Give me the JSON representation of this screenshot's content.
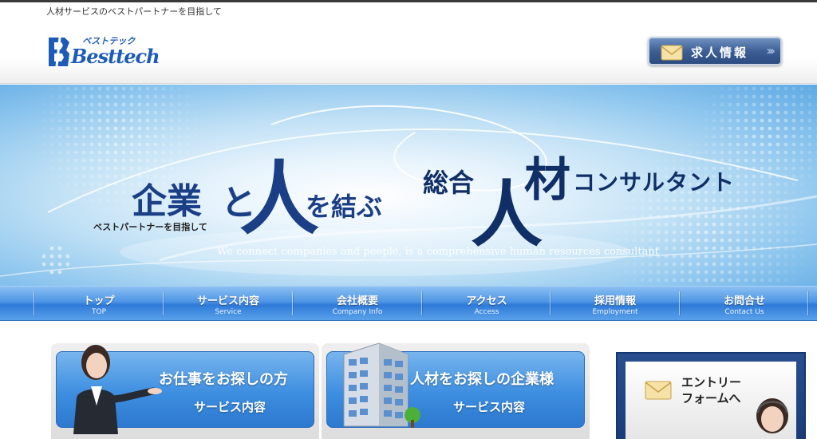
{
  "header": {
    "tagline": "人材サービスのベストパートナーを目指して",
    "logo_text": "Besttech",
    "logo_kana": "ベストテック",
    "recruit_button": "求人情報"
  },
  "hero": {
    "line1_a": "企業",
    "line1_b": "と",
    "line1_big": "人",
    "line1_c": "を結ぶ",
    "line2_a": "総合",
    "line2_big": "人",
    "line2_b": "材",
    "line2_c": "コンサルタント",
    "subtitle": "ベストパートナーを目指して",
    "english": "We connect companies and people, is a comprehensive human resources consultant"
  },
  "nav": {
    "items": [
      {
        "jp": "トップ",
        "en": "TOP"
      },
      {
        "jp": "サービス内容",
        "en": "Service"
      },
      {
        "jp": "会社概要",
        "en": "Company Info"
      },
      {
        "jp": "アクセス",
        "en": "Access"
      },
      {
        "jp": "採用情報",
        "en": "Employment"
      },
      {
        "jp": "お問合せ",
        "en": "Contact Us"
      }
    ]
  },
  "cards": [
    {
      "title": "お仕事をお探しの方",
      "sub": "サービス内容"
    },
    {
      "title": "人材をお探しの企業様",
      "sub": "サービス内容"
    }
  ],
  "entry": {
    "line1": "エントリー",
    "line2": "フォームへ"
  },
  "colors": {
    "brand_blue": "#1d5bb8",
    "nav_blue": "#3d8ee0",
    "hero_text": "#1a3f86"
  }
}
